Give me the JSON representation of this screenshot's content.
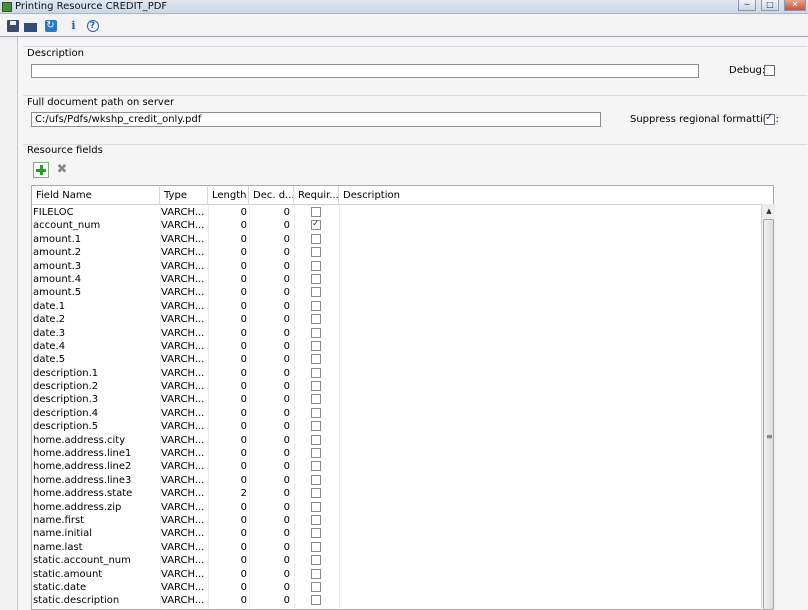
{
  "window": {
    "title": "Printing Resource CREDIT_PDF",
    "min_glyph": "─",
    "max_glyph": "□",
    "close_glyph": "✕"
  },
  "toolbar": {
    "save_icon": "save-icon",
    "upload_icon": "upload-icon",
    "refresh_icon": "refresh-icon",
    "info_glyph": "i",
    "help_glyph": "?"
  },
  "description": {
    "label": "Description",
    "value": "",
    "debug_label": "Debug:",
    "debug_checked": false
  },
  "path": {
    "label": "Full document path on server",
    "value": "C:/ufs/Pdfs/wkshp_credit_only.pdf",
    "suppress_label": "Suppress regional formatting:",
    "suppress_checked": true
  },
  "resource": {
    "label": "Resource fields",
    "del_glyph": "✖",
    "columns": [
      "Field Name",
      "Type",
      "Length",
      "Dec. d...",
      "Requir...",
      "Description"
    ],
    "rows": [
      {
        "name": "FILELOC",
        "type": "VARCH...",
        "length": "0",
        "dec": "0",
        "required": false
      },
      {
        "name": "account_num",
        "type": "VARCH...",
        "length": "0",
        "dec": "0",
        "required": true
      },
      {
        "name": "amount.1",
        "type": "VARCH...",
        "length": "0",
        "dec": "0",
        "required": false
      },
      {
        "name": "amount.2",
        "type": "VARCH...",
        "length": "0",
        "dec": "0",
        "required": false
      },
      {
        "name": "amount.3",
        "type": "VARCH...",
        "length": "0",
        "dec": "0",
        "required": false
      },
      {
        "name": "amount.4",
        "type": "VARCH...",
        "length": "0",
        "dec": "0",
        "required": false
      },
      {
        "name": "amount.5",
        "type": "VARCH...",
        "length": "0",
        "dec": "0",
        "required": false
      },
      {
        "name": "date.1",
        "type": "VARCH...",
        "length": "0",
        "dec": "0",
        "required": false
      },
      {
        "name": "date.2",
        "type": "VARCH...",
        "length": "0",
        "dec": "0",
        "required": false
      },
      {
        "name": "date.3",
        "type": "VARCH...",
        "length": "0",
        "dec": "0",
        "required": false
      },
      {
        "name": "date.4",
        "type": "VARCH...",
        "length": "0",
        "dec": "0",
        "required": false
      },
      {
        "name": "date.5",
        "type": "VARCH...",
        "length": "0",
        "dec": "0",
        "required": false
      },
      {
        "name": "description.1",
        "type": "VARCH...",
        "length": "0",
        "dec": "0",
        "required": false
      },
      {
        "name": "description.2",
        "type": "VARCH...",
        "length": "0",
        "dec": "0",
        "required": false
      },
      {
        "name": "description.3",
        "type": "VARCH...",
        "length": "0",
        "dec": "0",
        "required": false
      },
      {
        "name": "description.4",
        "type": "VARCH...",
        "length": "0",
        "dec": "0",
        "required": false
      },
      {
        "name": "description.5",
        "type": "VARCH...",
        "length": "0",
        "dec": "0",
        "required": false
      },
      {
        "name": "home.address.city",
        "type": "VARCH...",
        "length": "0",
        "dec": "0",
        "required": false
      },
      {
        "name": "home.address.line1",
        "type": "VARCH...",
        "length": "0",
        "dec": "0",
        "required": false
      },
      {
        "name": "home.address.line2",
        "type": "VARCH...",
        "length": "0",
        "dec": "0",
        "required": false
      },
      {
        "name": "home.address.line3",
        "type": "VARCH...",
        "length": "0",
        "dec": "0",
        "required": false
      },
      {
        "name": "home.address.state",
        "type": "VARCH...",
        "length": "2",
        "dec": "0",
        "required": false
      },
      {
        "name": "home.address.zip",
        "type": "VARCH...",
        "length": "0",
        "dec": "0",
        "required": false
      },
      {
        "name": "name.first",
        "type": "VARCH...",
        "length": "0",
        "dec": "0",
        "required": false
      },
      {
        "name": "name.initial",
        "type": "VARCH...",
        "length": "0",
        "dec": "0",
        "required": false
      },
      {
        "name": "name.last",
        "type": "VARCH...",
        "length": "0",
        "dec": "0",
        "required": false
      },
      {
        "name": "static.account_num",
        "type": "VARCH...",
        "length": "0",
        "dec": "0",
        "required": false
      },
      {
        "name": "static.amount",
        "type": "VARCH...",
        "length": "0",
        "dec": "0",
        "required": false
      },
      {
        "name": "static.date",
        "type": "VARCH...",
        "length": "0",
        "dec": "0",
        "required": false
      },
      {
        "name": "static.description",
        "type": "VARCH...",
        "length": "0",
        "dec": "0",
        "required": false
      },
      {
        "name": "",
        "type": "",
        "length": "",
        "dec": "",
        "required": false
      }
    ]
  },
  "scroll": {
    "up_glyph": "▲",
    "grip_glyph": "≡"
  }
}
